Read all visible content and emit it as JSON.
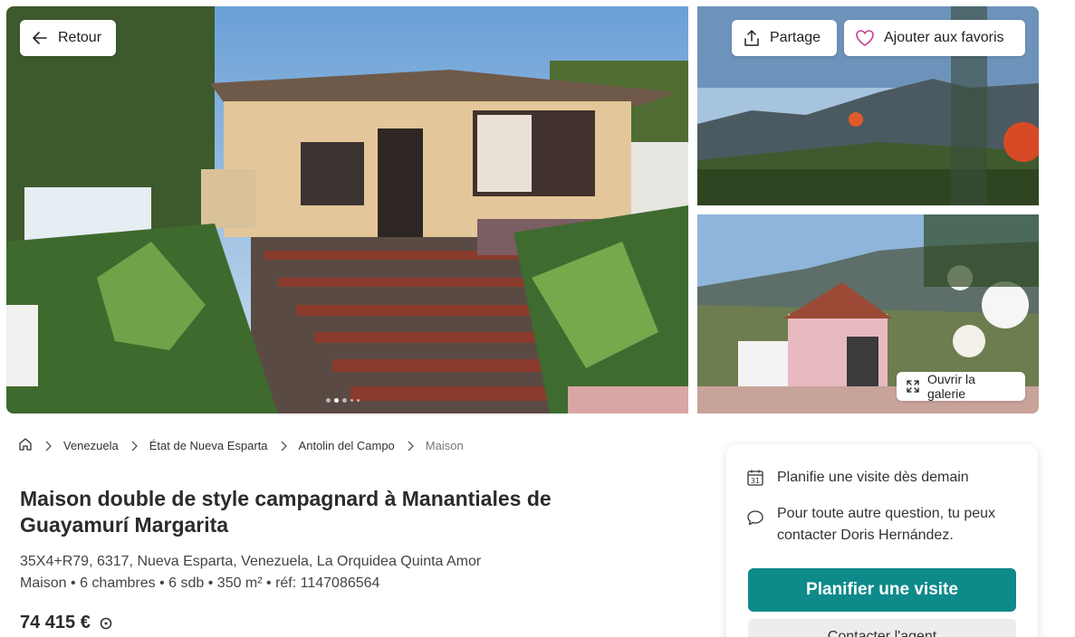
{
  "gallery": {
    "back_label": "Retour",
    "share_label": "Partage",
    "favorite_label": "Ajouter aux favoris",
    "open_gallery_label": "Ouvrir la galerie",
    "carousel": {
      "total": 5,
      "active_index": 1
    }
  },
  "breadcrumb": {
    "home_icon": "home-icon",
    "items": [
      "Venezuela",
      "État de Nueva Esparta",
      "Antolin del Campo"
    ],
    "current": "Maison"
  },
  "listing": {
    "title": "Maison double de style campagnard à Manantiales de Guayamurí Margarita",
    "address": "35X4+R79, 6317, Nueva Esparta, Venezuela, La Orquidea Quinta Amor",
    "specs": "Maison • 6 chambres • 6 sdb • 350 m² • réf: 1147086564",
    "price": "74 415 €"
  },
  "contact_card": {
    "visit_text": "Planifie une visite dès demain",
    "question_text": "Pour toute autre question, tu peux contacter Doris Hernández.",
    "primary_button": "Planifier une visite",
    "secondary_button": "Contacter l'agent",
    "calendar_icon_day": "31"
  },
  "colors": {
    "accent": "#0e8a8a",
    "heart": "#c2408f"
  }
}
